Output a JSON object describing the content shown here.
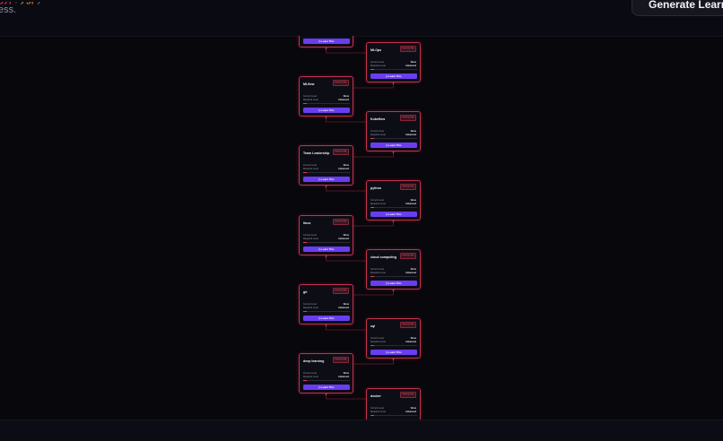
{
  "header": {
    "subtitle_line1_parts": [
      "g",
      "y",
      "p",
      ", ",
      "y",
      "g",
      "p",
      "y"
    ],
    "subtitle_line2": "ess.",
    "generate_button_label": "Generate Learn"
  },
  "card_labels": {
    "badge": "Learning Gap",
    "current_label": "Current Level",
    "required_label": "Required Level",
    "learn_button": "Learn This",
    "learn_icon": "play-icon"
  },
  "colors": {
    "background": "#07070c",
    "card_border": "#c4314b",
    "button": "#6a3df0",
    "connector": "#b8304a"
  },
  "cards": [
    {
      "title": "",
      "current": "None",
      "required": "Advanced",
      "progress": 0.08,
      "col": "left",
      "partial": "top"
    },
    {
      "title": "MLOps",
      "current": "None",
      "required": "Advanced",
      "progress": 0.08,
      "col": "right"
    },
    {
      "title": "MLflow",
      "current": "None",
      "required": "Advanced",
      "progress": 0.08,
      "col": "left"
    },
    {
      "title": "Kubeflow",
      "current": "None",
      "required": "Advanced",
      "progress": 0.08,
      "col": "right"
    },
    {
      "title": "Team Leadership",
      "current": "None",
      "required": "Advanced",
      "progress": 0.08,
      "col": "left"
    },
    {
      "title": "python",
      "current": "None",
      "required": "Advanced",
      "progress": 0.08,
      "col": "right"
    },
    {
      "title": "linux",
      "current": "None",
      "required": "Advanced",
      "progress": 0.08,
      "col": "left"
    },
    {
      "title": "cloud computing",
      "current": "None",
      "required": "Advanced",
      "progress": 0.08,
      "col": "right"
    },
    {
      "title": "git",
      "current": "None",
      "required": "Advanced",
      "progress": 0.08,
      "col": "left"
    },
    {
      "title": "sql",
      "current": "None",
      "required": "Advanced",
      "progress": 0.08,
      "col": "right"
    },
    {
      "title": "deep learning",
      "current": "None",
      "required": "Advanced",
      "progress": 0.08,
      "col": "left"
    },
    {
      "title": "docker",
      "current": "None",
      "required": "Advanced",
      "progress": 0.08,
      "col": "right"
    },
    {
      "title": "",
      "current": "",
      "required": "",
      "progress": 0,
      "col": "left",
      "partial": "bottom"
    }
  ]
}
